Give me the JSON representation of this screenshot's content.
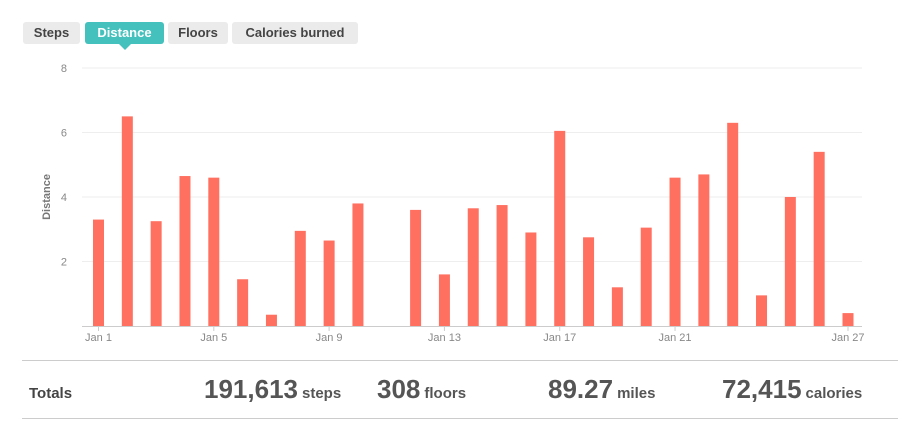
{
  "tabs": [
    {
      "label": "Steps",
      "active": false
    },
    {
      "label": "Distance",
      "active": true
    },
    {
      "label": "Floors",
      "active": false
    },
    {
      "label": "Calories burned",
      "active": false
    }
  ],
  "chart_data": {
    "type": "bar",
    "ylabel": "Distance",
    "ylim": [
      0,
      8
    ],
    "yticks": [
      "2",
      "4",
      "6",
      "8"
    ],
    "grid": true,
    "bar_color": "#ff7060",
    "categories": [
      "Jan 1",
      "Jan 2",
      "Jan 3",
      "Jan 4",
      "Jan 5",
      "Jan 6",
      "Jan 7",
      "Jan 8",
      "Jan 9",
      "Jan 10",
      "Jan 11",
      "Jan 12",
      "Jan 13",
      "Jan 14",
      "Jan 15",
      "Jan 16",
      "Jan 17",
      "Jan 18",
      "Jan 19",
      "Jan 20",
      "Jan 21",
      "Jan 22",
      "Jan 23",
      "Jan 24",
      "Jan 25",
      "Jan 26",
      "Jan 27"
    ],
    "values": [
      3.3,
      6.5,
      3.25,
      4.65,
      4.6,
      1.45,
      0.35,
      2.95,
      2.65,
      3.8,
      0,
      3.6,
      1.6,
      3.65,
      3.75,
      2.9,
      6.05,
      2.75,
      1.2,
      3.05,
      4.6,
      4.7,
      6.3,
      0.95,
      4.0,
      5.4,
      0.4
    ],
    "xtick_labels": [
      "Jan 1",
      "Jan 5",
      "Jan 9",
      "Jan 13",
      "Jan 17",
      "Jan 21",
      "Jan 27"
    ]
  },
  "totals": {
    "label": "Totals",
    "steps": {
      "value": "191,613",
      "unit": "steps"
    },
    "floors": {
      "value": "308",
      "unit": "floors"
    },
    "miles": {
      "value": "89.27",
      "unit": "miles"
    },
    "calories": {
      "value": "72,415",
      "unit": "calories"
    }
  }
}
